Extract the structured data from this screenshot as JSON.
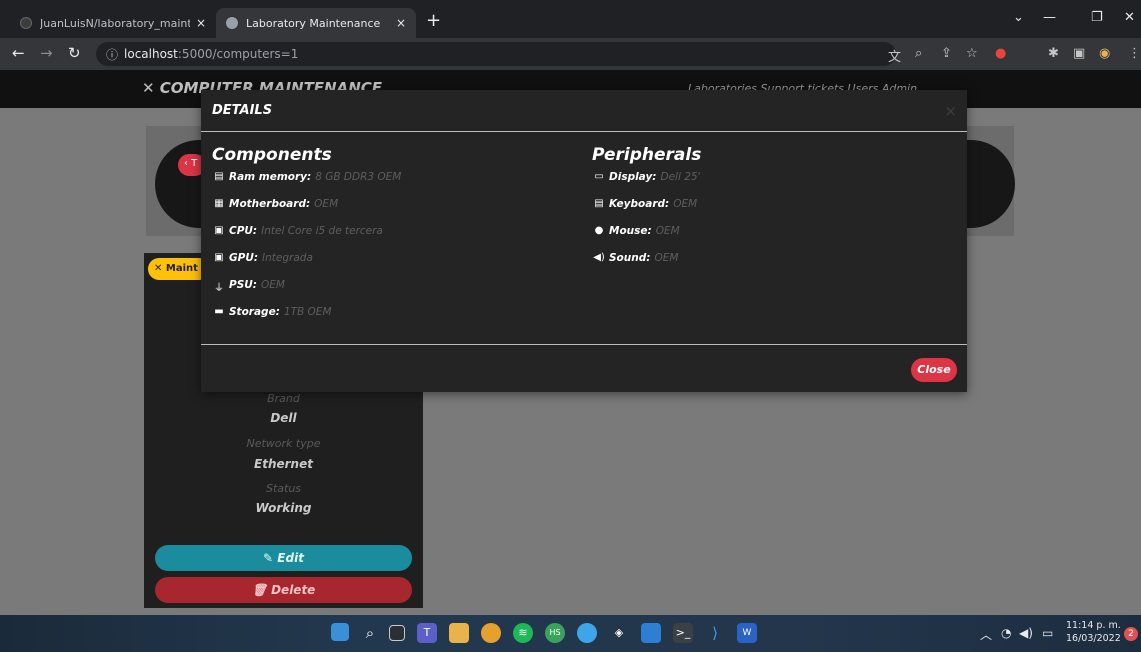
{
  "browser": {
    "tabs": [
      {
        "title": "JuanLuisN/laboratory_maintenan",
        "close": "×"
      },
      {
        "title": "Laboratory Maintenance",
        "close": "×"
      }
    ],
    "new_tab": "+",
    "address": {
      "host": "localhost",
      "path": ":5000/computers=1"
    }
  },
  "navbar": {
    "brand": "COMPUTER MAINTENANCE",
    "links": "Laboratories   Support tickets   Users   Admin"
  },
  "card": {
    "back_label": "‹ T",
    "maintenance_label": "Maint",
    "fields": [
      {
        "label": "Brand",
        "value": "Dell"
      },
      {
        "label": "Network type",
        "value": "Ethernet"
      },
      {
        "label": "Status",
        "value": "Working"
      }
    ],
    "edit_label": "Edit",
    "delete_label": "Delete"
  },
  "modal": {
    "title": "DETAILS",
    "close_x": "×",
    "components": {
      "heading": "Components",
      "items": [
        {
          "label": "Ram memory:",
          "value": "8 GB DDR3 OEM",
          "icon": "memory-icon"
        },
        {
          "label": "Motherboard:",
          "value": "OEM",
          "icon": "motherboard-icon"
        },
        {
          "label": "CPU:",
          "value": "Intel Core i5 de tercera",
          "icon": "cpu-icon"
        },
        {
          "label": "GPU:",
          "value": "Integrada",
          "icon": "gpu-icon"
        },
        {
          "label": "PSU:",
          "value": "OEM",
          "icon": "plug-icon"
        },
        {
          "label": "Storage:",
          "value": "1TB OEM",
          "icon": "hdd-icon"
        }
      ]
    },
    "peripherals": {
      "heading": "Peripherals",
      "items": [
        {
          "label": "Display:",
          "value": "Dell 25'",
          "icon": "display-icon"
        },
        {
          "label": "Keyboard:",
          "value": "OEM",
          "icon": "keyboard-icon"
        },
        {
          "label": "Mouse:",
          "value": "OEM",
          "icon": "mouse-icon"
        },
        {
          "label": "Sound:",
          "value": "OEM",
          "icon": "speaker-icon"
        }
      ]
    },
    "close_label": "Close"
  },
  "taskbar": {
    "time": "11:14 p. m.",
    "date": "16/03/2022",
    "notifications": "2"
  }
}
